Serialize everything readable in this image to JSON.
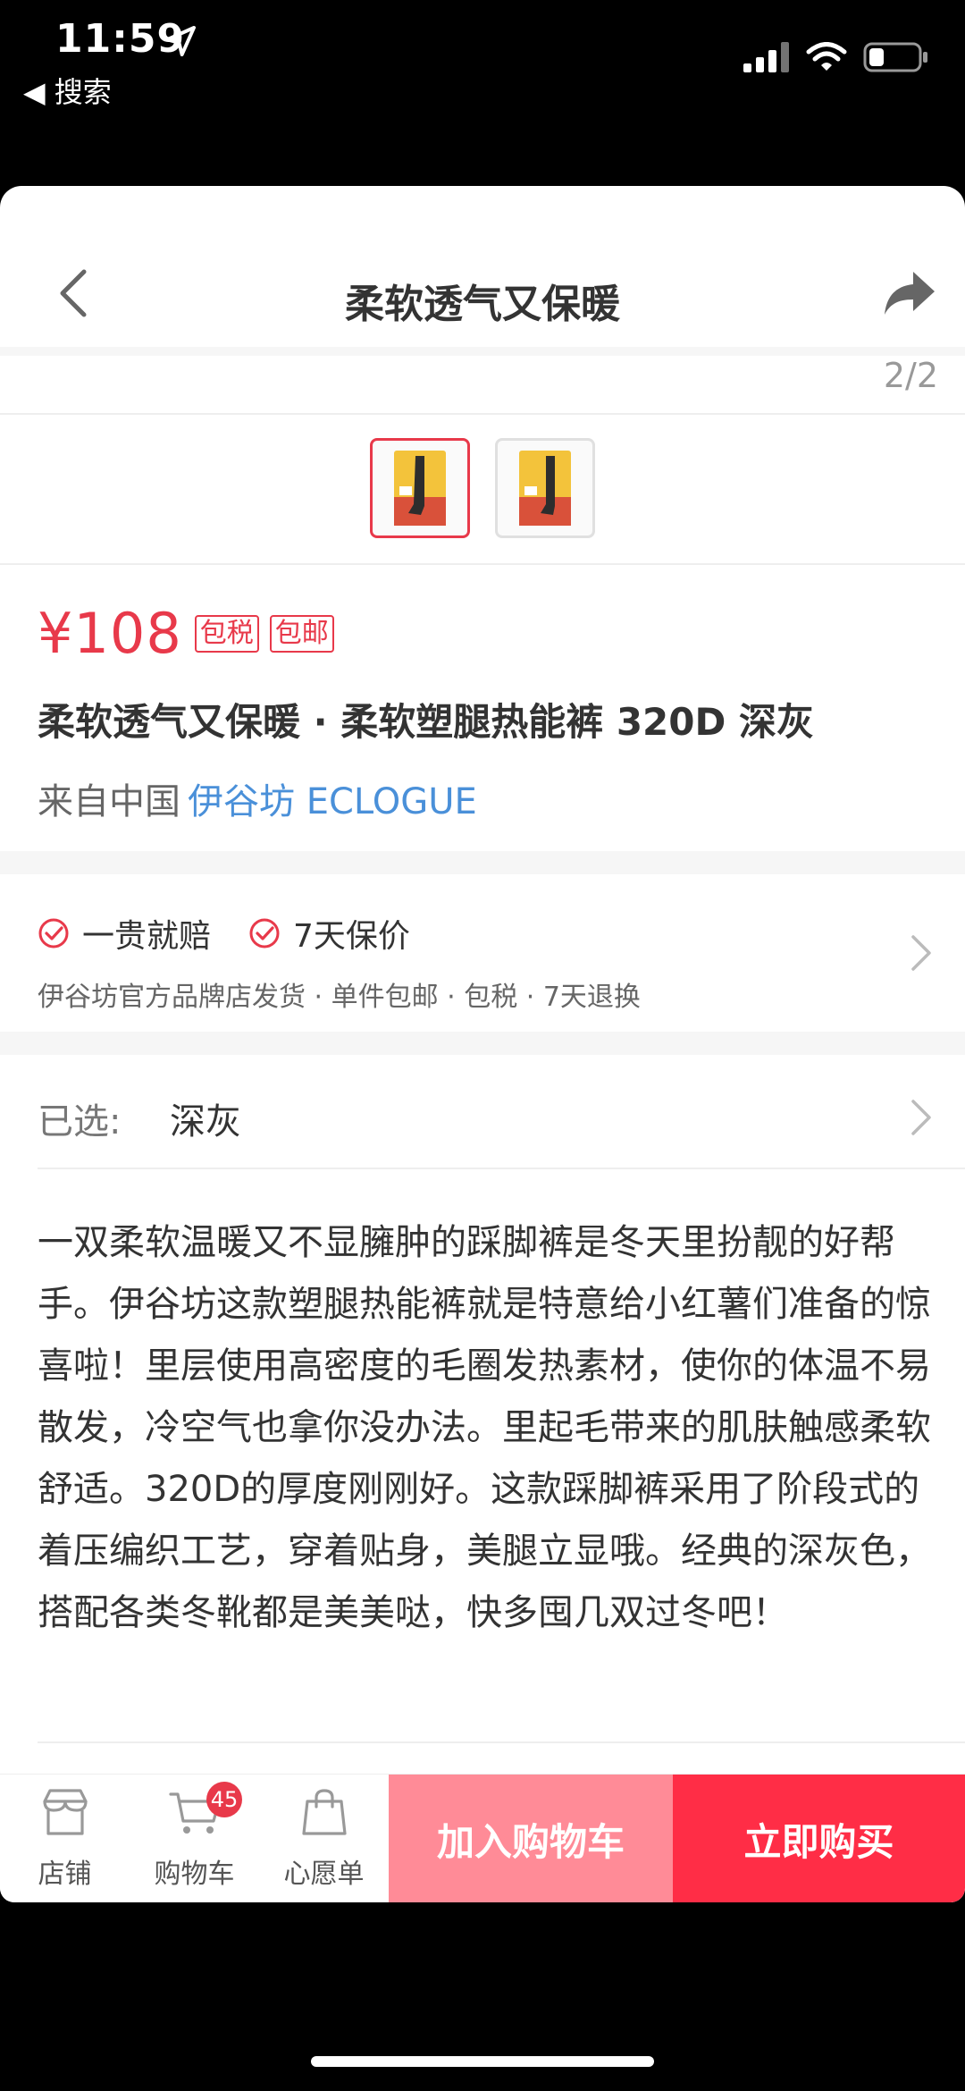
{
  "status_bar": {
    "time": "11:59",
    "back_label": "◀ 搜索"
  },
  "nav": {
    "title": "柔软透气又保暖"
  },
  "gallery": {
    "counter": "2/2"
  },
  "product": {
    "price": "¥108",
    "tags": [
      "包税",
      "包邮"
    ],
    "title": "柔软透气又保暖 · 柔软塑腿热能裤 320D 深灰",
    "origin_prefix": "来自中国",
    "brand": "伊谷坊 ECLOGUE"
  },
  "guarantee": {
    "items": [
      "一贵就赔",
      "7天保价"
    ],
    "description": "伊谷坊官方品牌店发货 · 单件包邮 · 包税 · 7天退换"
  },
  "selection": {
    "label": "已选:",
    "value": "深灰"
  },
  "description": "一双柔软温暖又不显臃肿的踩脚裤是冬天里扮靓的好帮手。伊谷坊这款塑腿热能裤就是特意给小红薯们准备的惊喜啦！里层使用高密度的毛圈发热素材，使你的体温不易散发，冷空气也拿你没办法。里起毛带来的肌肤触感柔软舒适。320D的厚度刚刚好。这款踩脚裤采用了阶段式的着压编织工艺，穿着贴身，美腿立显哦。经典的深灰色，搭配各类冬靴都是美美哒，快多囤几双过冬吧！",
  "action_bar": {
    "store_label": "店铺",
    "cart_label": "购物车",
    "cart_badge": "45",
    "wishlist_label": "心愿单",
    "add_cart_label": "加入购物车",
    "buy_now_label": "立即购买"
  },
  "colors": {
    "accent": "#e8394a",
    "brand_link": "#4a90d9",
    "add_cart_bg": "#ff8b97",
    "buy_now_bg": "#ff2d46"
  }
}
